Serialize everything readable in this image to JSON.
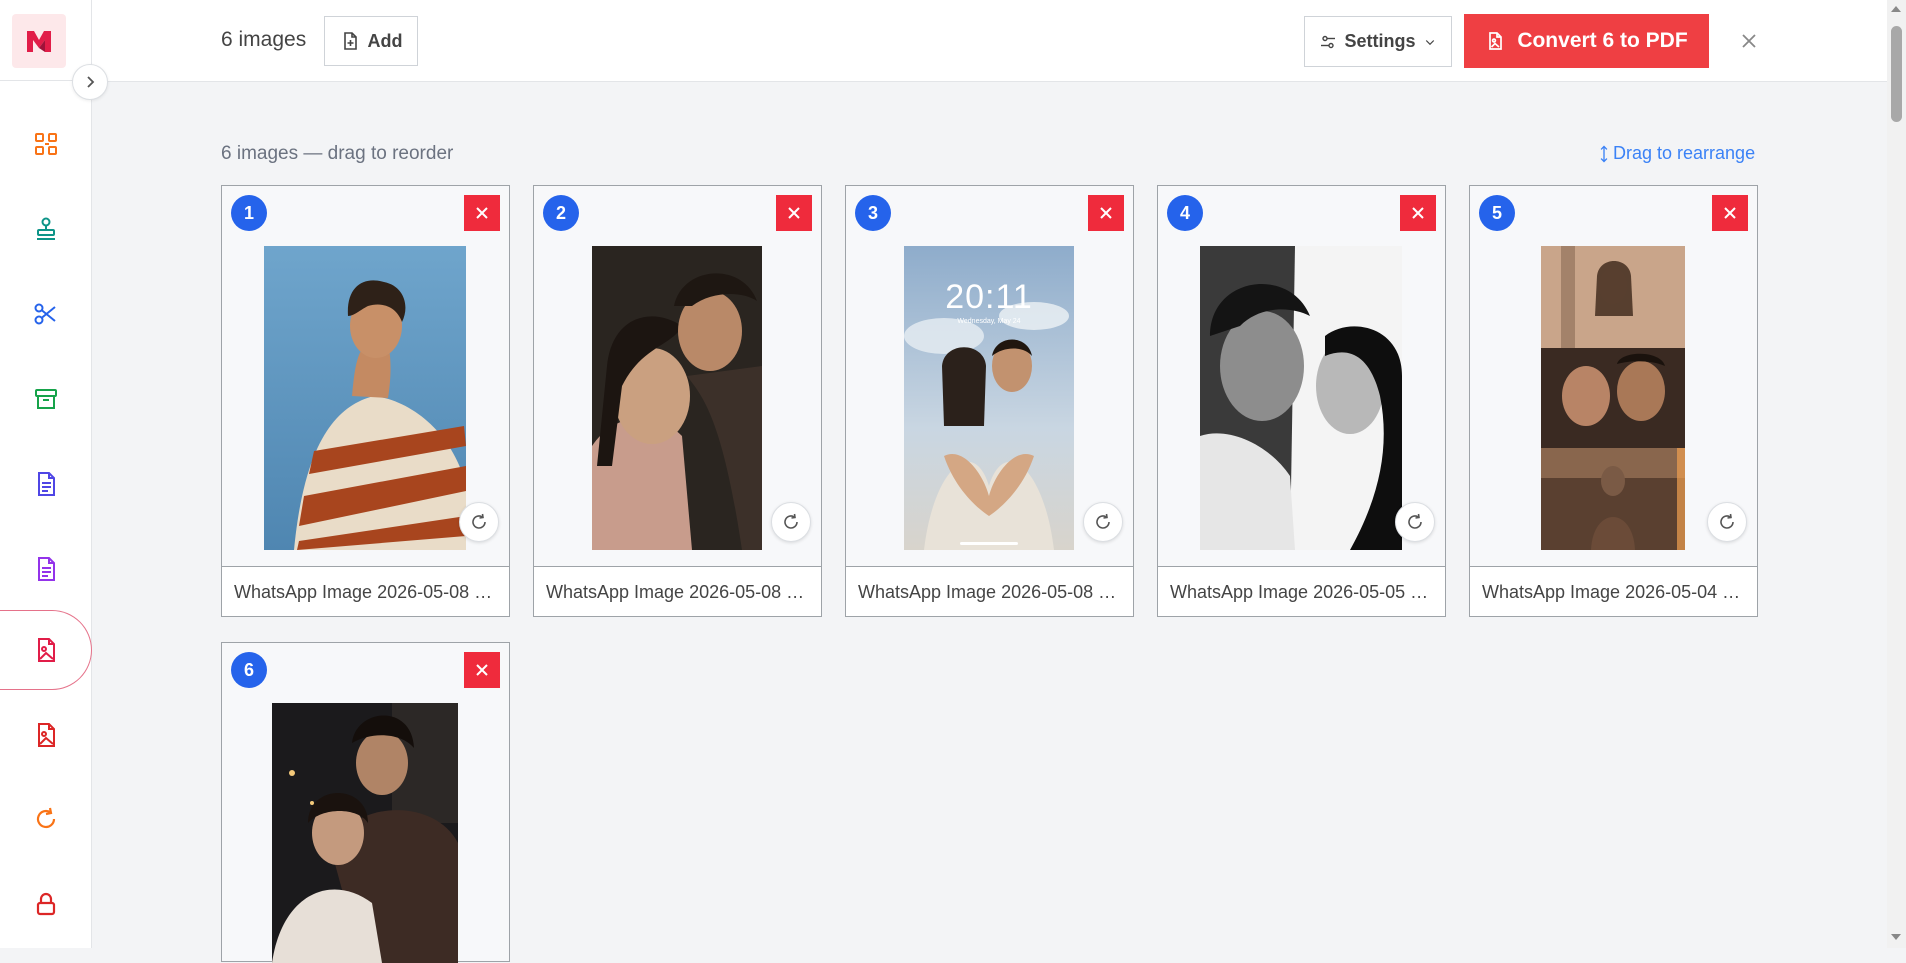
{
  "topbar": {
    "count_label": "6 images",
    "add_label": "Add",
    "settings_label": "Settings",
    "convert_label": "Convert 6 to PDF"
  },
  "content": {
    "section_label": "6 images — drag to reorder",
    "drag_hint": "Drag to rearrange"
  },
  "sidebar": {
    "items": [
      {
        "icon": "organize-icon",
        "color": "#f97316"
      },
      {
        "icon": "stamp-icon",
        "color": "#0d9488"
      },
      {
        "icon": "scissors-icon",
        "color": "#2563eb"
      },
      {
        "icon": "archive-icon",
        "color": "#16a34a"
      },
      {
        "icon": "document-icon",
        "color": "#4f46e5"
      },
      {
        "icon": "document-icon",
        "color": "#9333ea"
      },
      {
        "icon": "image-file-icon",
        "color": "#e11d48",
        "active": true
      },
      {
        "icon": "image-file-icon",
        "color": "#dc2626"
      },
      {
        "icon": "rotate-icon",
        "color": "#f97316"
      },
      {
        "icon": "lock-icon",
        "color": "#dc2626"
      }
    ]
  },
  "images": [
    {
      "number": "1",
      "filename": "WhatsApp Image 2026-05-08 a..."
    },
    {
      "number": "2",
      "filename": "WhatsApp Image 2026-05-08 a..."
    },
    {
      "number": "3",
      "filename": "WhatsApp Image 2026-05-08 a...",
      "lock_time": "20:11",
      "lock_date": "Wednesday, May 24"
    },
    {
      "number": "4",
      "filename": "WhatsApp Image 2026-05-05 a..."
    },
    {
      "number": "5",
      "filename": "WhatsApp Image 2026-05-04 a..."
    },
    {
      "number": "6",
      "filename": ""
    }
  ],
  "colors": {
    "accent_red": "#ef3f43",
    "badge_blue": "#2563eb",
    "link_blue": "#3b82f6"
  }
}
